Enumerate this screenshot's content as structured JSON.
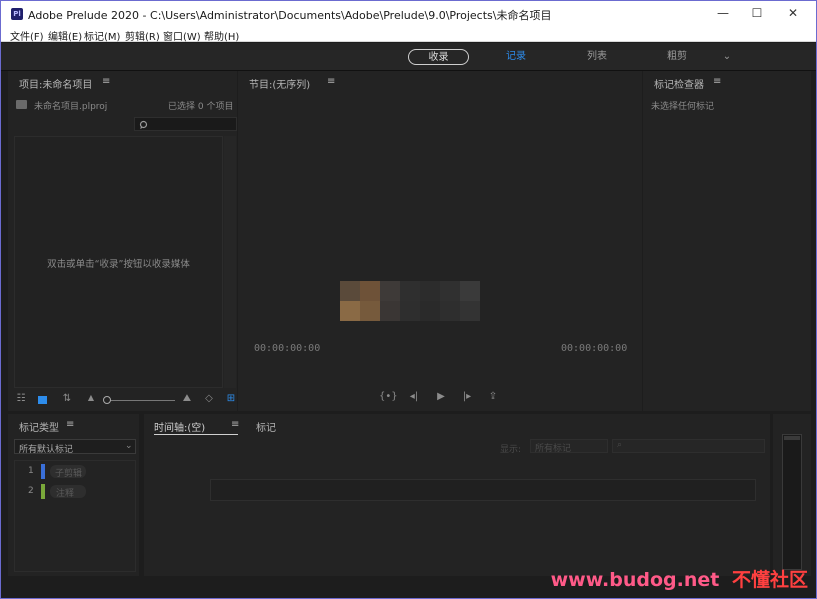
{
  "window": {
    "app_icon_label": "Pl",
    "title": "Adobe Prelude 2020 - C:\\Users\\Administrator\\Documents\\Adobe\\Prelude\\9.0\\Projects\\未命名项目",
    "controls": {
      "minimize": "—",
      "maximize": "☐",
      "close": "✕"
    }
  },
  "menubar": {
    "items": [
      "文件(F)",
      "编辑(E)",
      "标记(M)",
      "剪辑(R)",
      "窗口(W)",
      "帮助(H)"
    ]
  },
  "workspaces": {
    "items": [
      "收录",
      "记录",
      "列表",
      "粗剪"
    ],
    "selected": "收录",
    "active_tab": "记录",
    "more_glyph": "⌄"
  },
  "project_panel": {
    "title": "项目:未命名项目",
    "menu_glyph": "≡",
    "file_name": "未命名项目.plproj",
    "selection_status": "已选择 0 个项目",
    "empty_hint": "双击或单击“收录”按钮以收录媒体"
  },
  "program_panel": {
    "title": "节目:(无序列)",
    "menu_glyph": "≡",
    "timecode_left": "00:00:00:00",
    "timecode_right": "00:00:00:00",
    "transport": [
      "{•}",
      "◂|",
      "▶",
      "|▸",
      "⇪"
    ]
  },
  "marker_inspector": {
    "title": "标记检查器",
    "menu_glyph": "≡",
    "status": "未选择任何标记"
  },
  "marker_type": {
    "title": "标记类型",
    "menu_glyph": "≡",
    "filter_value": "所有默认标记",
    "types": [
      {
        "num": "1",
        "label": "子剪辑",
        "color": "#3a6fd8"
      },
      {
        "num": "2",
        "label": "注释",
        "color": "#7aa83a"
      }
    ]
  },
  "timeline": {
    "tabs": [
      "时间轴:(空)",
      "标记"
    ],
    "menu_glyph": "≡",
    "show_label": "显示:",
    "show_value": "所有标记"
  },
  "watermark": {
    "url": "www.budog.net",
    "name": "不懂社区"
  },
  "colors": {
    "accent_blue": "#2d8ceb",
    "window_frame": "#6b6bd0",
    "panel_bg": "#232323",
    "workspace_bg": "#262626"
  }
}
